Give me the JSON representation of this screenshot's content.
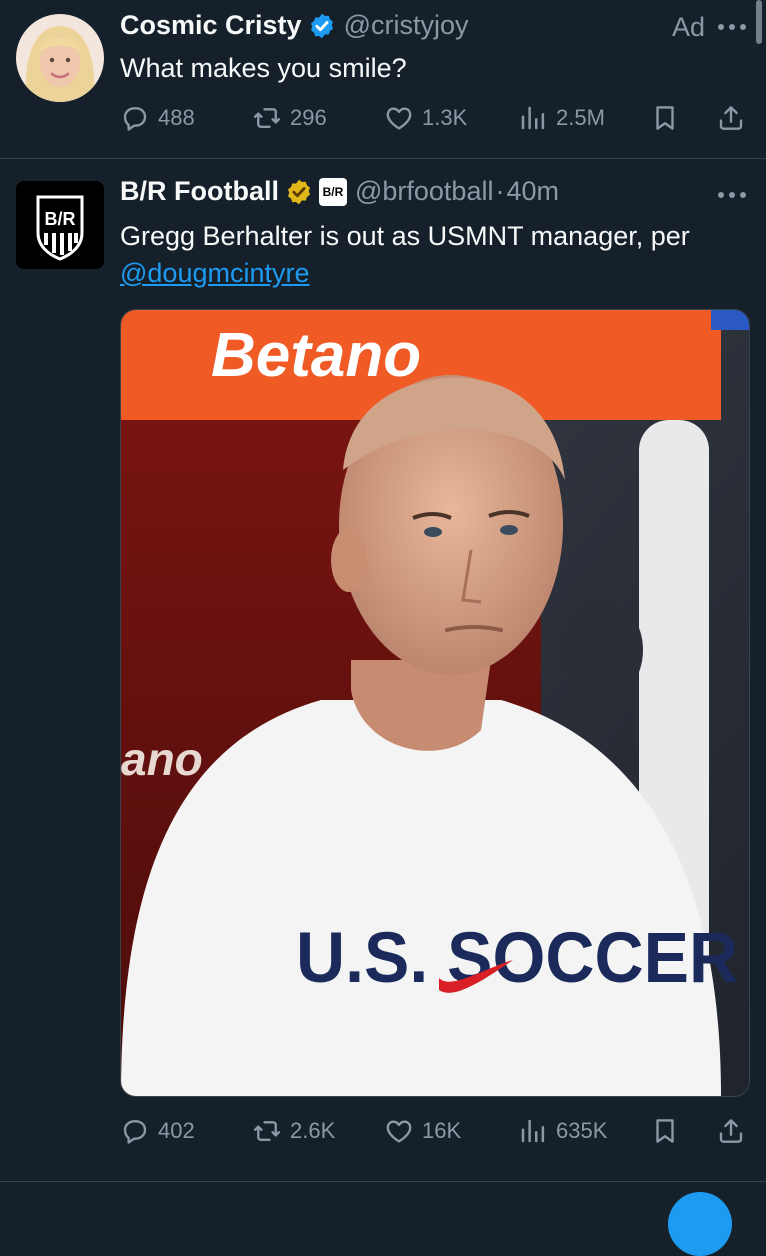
{
  "ad_tweet": {
    "display_name": "Cosmic Cristy",
    "handle": "@cristyjoy",
    "ad_label": "Ad",
    "text": "What makes you smile?",
    "replies": "488",
    "reposts": "296",
    "likes": "1.3K",
    "views": "2.5M"
  },
  "news_tweet": {
    "display_name": "B/R Football",
    "affiliate_badge": "B/R",
    "handle": "@brfootball",
    "separator": "·",
    "time": "40m",
    "text": "Gregg Berhalter is out as USMNT manager, per",
    "mention": "@dougmcintyre",
    "avatar_logo": "B/R",
    "image": {
      "sponsor_banner": "Betano",
      "board_fragment": "ano",
      "shirt_text": "U.S. SOCCER"
    },
    "replies": "402",
    "reposts": "2.6K",
    "likes": "16K",
    "views": "635K"
  },
  "colors": {
    "background": "#15202b",
    "accent": "#1d9bf0",
    "muted": "#8b98a5",
    "verified_blue": "#1d9bf0",
    "verified_gold": "#e2b719"
  }
}
